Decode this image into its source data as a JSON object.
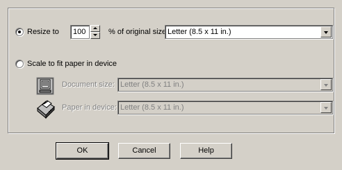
{
  "resize": {
    "label": "Resize to",
    "value": "100",
    "percent_label": "% of original size",
    "paper_selected": "Letter (8.5 x 11 in.)",
    "selected": true
  },
  "scale": {
    "label": "Scale to fit paper in device",
    "selected": false,
    "document_size_label": "Document size:",
    "document_size_value": "Letter (8.5 x 11 in.)",
    "paper_in_device_label": "Paper in device:",
    "paper_in_device_value": "Letter (8.5 x 11 in.)"
  },
  "buttons": {
    "ok": "OK",
    "cancel": "Cancel",
    "help": "Help"
  },
  "icons": {
    "document": "monitor-document-icon",
    "printer": "printer-icon"
  }
}
